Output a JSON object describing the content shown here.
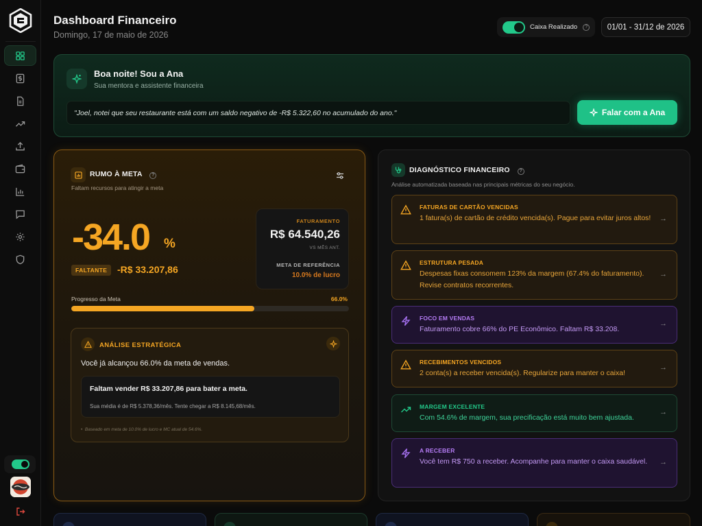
{
  "header": {
    "title": "Dashboard Financeiro",
    "date": "Domingo, 17 de maio de 2026",
    "cash_toggle_label": "Caixa Realizado",
    "cash_toggle_on": true,
    "date_range": "01/01 - 31/12 de 2026"
  },
  "sidebar": {
    "items": [
      {
        "icon": "dashboard-icon",
        "active": true
      },
      {
        "icon": "dollar-icon",
        "active": false
      },
      {
        "icon": "document-icon",
        "active": false
      },
      {
        "icon": "trend-up-icon",
        "active": false
      },
      {
        "icon": "upload-icon",
        "active": false
      },
      {
        "icon": "wallet-icon",
        "active": false
      },
      {
        "icon": "bar-chart-icon",
        "active": false
      },
      {
        "icon": "chat-icon",
        "active": false
      },
      {
        "icon": "gear-icon",
        "active": false
      },
      {
        "icon": "shield-icon",
        "active": false
      }
    ],
    "toggle_on": true
  },
  "ana": {
    "title": "Boa noite! Sou a Ana",
    "subtitle": "Sua mentora e assistente financeira",
    "quote": "\"Joel, notei que seu restaurante está com um saldo negativo de -R$ 5.322,60 no acumulado do ano.\"",
    "button_label": "Falar com a Ana"
  },
  "meta": {
    "title": "RUMO À META",
    "subtitle": "Faltam recursos para atingir a meta",
    "percent": "-34.0",
    "percent_unit": "%",
    "faltante_label": "FALTANTE",
    "faltante_value": "-R$ 33.207,86",
    "faturamento_label": "FATURAMENTO",
    "faturamento_value": "R$ 64.540,26",
    "vs_label": "VS MÊS ANT.",
    "meta_ref_label": "META DE REFERÊNCIA",
    "meta_ref_value": "10.0% de lucro",
    "progress_label": "Progresso da Meta",
    "progress_text": "66.0%",
    "progress": 0.66
  },
  "analise": {
    "title": "ANÁLISE ESTRATÉGICA",
    "text": "Você já alcançou 66.0% da meta de vendas.",
    "inner_title": "Faltam vender R$ 33.207,86 para bater a meta.",
    "inner_sub": "Sua média é de R$ 5.378,36/mês. Tente chegar a R$ 8.145,68/mês.",
    "footnote": "Baseado em meta de 10.0% de lucro e MC atual de 54.6%."
  },
  "diagnostico": {
    "title": "DIAGNÓSTICO FINANCEIRO",
    "subtitle": "Análise automatizada baseada nas principais métricas do seu negócio.",
    "alerts": [
      {
        "title": "FATURAS DE CARTÃO VENCIDAS",
        "text": "1 fatura(s) de cartão de crédito vencida(s). Pague para evitar juros altos!",
        "tone": "amber",
        "icon": "warning-icon"
      },
      {
        "title": "ESTRUTURA PESADA",
        "text": "Despesas fixas consomem 123% da margem (67.4% do faturamento). Revise contratos recorrentes.",
        "tone": "amber",
        "icon": "warning-icon"
      },
      {
        "title": "FOCO EM VENDAS",
        "text": "Faturamento cobre 66% do PE Econômico. Faltam R$ 33.208.",
        "tone": "purple",
        "icon": "lightning-icon"
      },
      {
        "title": "RECEBIMENTOS VENCIDOS",
        "text": "2 conta(s) a receber vencida(s). Regularize para manter o caixa!",
        "tone": "amber",
        "icon": "warning-icon"
      },
      {
        "title": "MARGEM EXCELENTE",
        "text": "Com 54.6% de margem, sua precificação está muito bem ajustada.",
        "tone": "green",
        "icon": "trend-up-icon"
      },
      {
        "title": "A RECEBER",
        "text": "Você tem R$ 750 a receber. Acompanhe para manter o caixa saudável.",
        "tone": "purple",
        "icon": "lightning-icon"
      }
    ]
  },
  "colors": {
    "accent_green": "#22c98a",
    "accent_amber": "#f5a623",
    "accent_purple": "#a470ee",
    "background": "#0b0b0b"
  }
}
